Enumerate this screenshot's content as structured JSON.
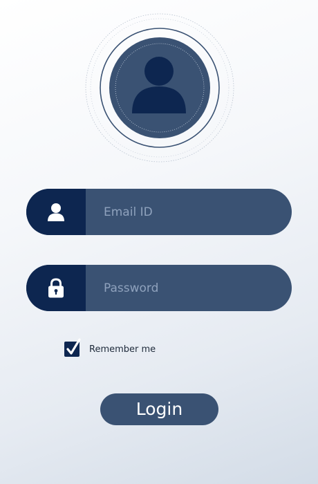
{
  "form": {
    "email_placeholder": "Email ID",
    "email_value": "",
    "password_placeholder": "Password",
    "password_value": "",
    "remember_label": "Remember me",
    "remember_checked": true,
    "login_label": "Login"
  },
  "icons": {
    "avatar": "user-avatar-icon",
    "email_field": "user-icon",
    "password_field": "lock-icon",
    "checkbox": "checkmark-icon"
  },
  "colors": {
    "navy_dark": "#0d2650",
    "navy_mid": "#3a5273",
    "placeholder": "#8fa2bd",
    "background_light": "#ffffff",
    "background_shade": "#d3dce7"
  }
}
